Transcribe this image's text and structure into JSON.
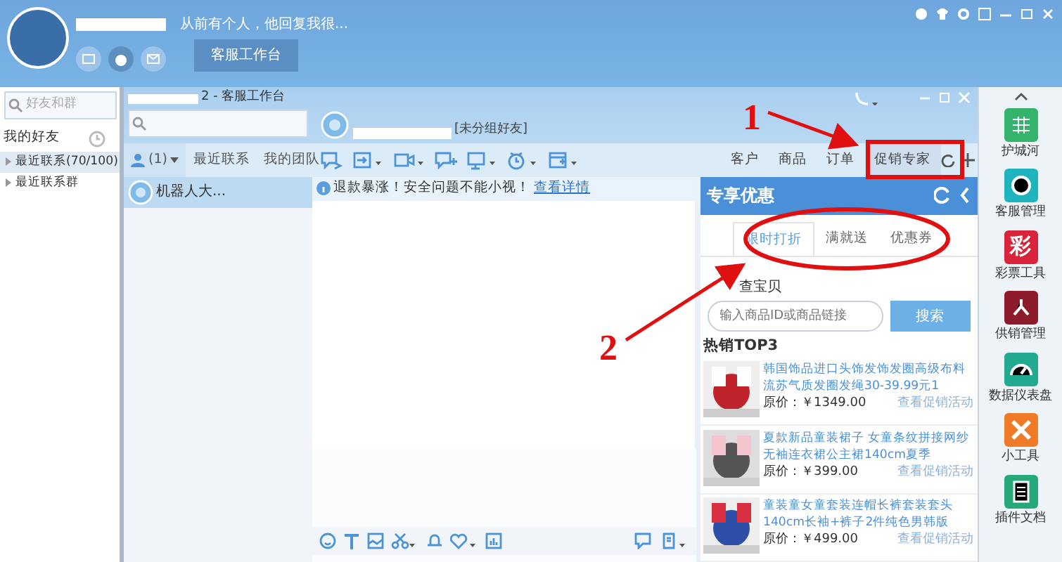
{
  "window": {
    "status": "从前有个人，他回复我很...",
    "tab": "客服工作台"
  },
  "contacts": {
    "search_placeholder": "好友和群",
    "tab": "我的好友",
    "tree": [
      {
        "label": "最近联系(70/100)",
        "expanded": false
      },
      {
        "label": "最近联系群",
        "expanded": false
      }
    ]
  },
  "workbench": {
    "title": "2 - 客服工作台",
    "list_tabs": [
      {
        "label": "(1)",
        "selected": true
      },
      {
        "label": "最近联系",
        "selected": false
      },
      {
        "label": "我的团队",
        "selected": false
      }
    ],
    "sessions": [
      {
        "name": "机器人大...",
        "selected": true
      }
    ]
  },
  "chat": {
    "contact_group": "[未分组好友]",
    "notice": "退款暴涨！安全问题不能小视！",
    "notice_link": "查看详情"
  },
  "side_tabs": [
    {
      "label": "客户",
      "selected": false
    },
    {
      "label": "商品",
      "selected": false
    },
    {
      "label": "订单",
      "selected": false
    },
    {
      "label": "促销专家",
      "selected": true
    }
  ],
  "promo": {
    "title": "专享优惠",
    "tabs": [
      {
        "label": "限时打折",
        "selected": true
      },
      {
        "label": "满就送",
        "selected": false
      },
      {
        "label": "优惠券",
        "selected": false
      }
    ],
    "search_label": "查宝贝",
    "search_placeholder": "输入商品ID或商品链接",
    "search_button": "搜索",
    "section": "热销TOP3",
    "products": [
      {
        "title": "韩国饰品进口头饰发饰发圈高级布料流苏气质发圈发绳30-39.99元1",
        "price": "原价：￥1349.00",
        "link": "查看促销活动"
      },
      {
        "title": "夏款新品童装裙子 女童条纹拼接网纱无袖连衣裙公主裙140cm夏季",
        "price": "原价：￥399.00",
        "link": "查看促销活动"
      },
      {
        "title": "童装童女童套装连帽长裤套装套头140cm长袖+裤子2件纯色男韩版",
        "price": "原价：￥499.00",
        "link": "查看促销活动"
      }
    ]
  },
  "apps": [
    {
      "label": "护城河",
      "kind": "grid",
      "color": "#34b36c"
    },
    {
      "label": "客服管理",
      "kind": "face",
      "color": "#1fb3bd"
    },
    {
      "label": "彩票工具",
      "kind": "glyph",
      "glyph": "彩",
      "color": "#d8233a"
    },
    {
      "label": "供销管理",
      "kind": "network",
      "color": "#8e1b2c"
    },
    {
      "label": "数据仪表盘",
      "kind": "gauge",
      "color": "#22a98f"
    },
    {
      "label": "小工具",
      "kind": "tools",
      "color": "#ef7b27"
    },
    {
      "label": "插件文档",
      "kind": "doc",
      "color": "#26a97a"
    }
  ],
  "annotations": [
    {
      "label": "1"
    },
    {
      "label": "2"
    }
  ]
}
